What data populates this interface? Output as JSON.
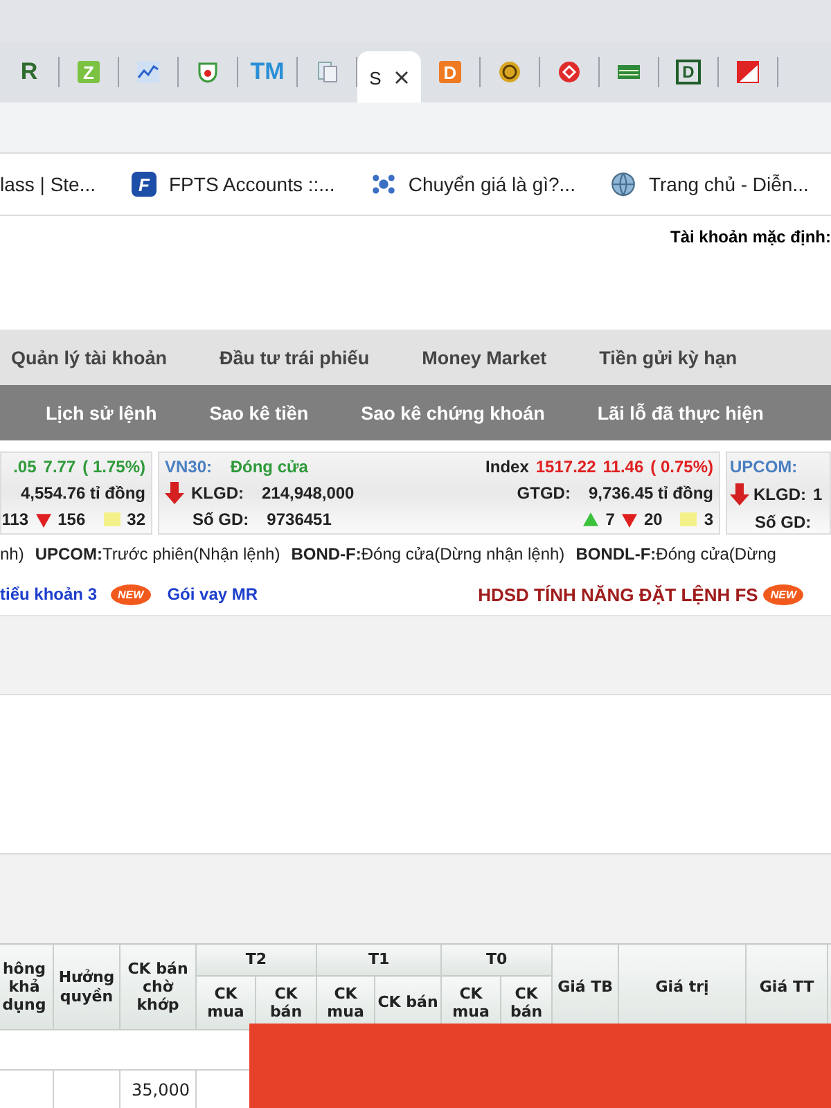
{
  "browser_tabs": [
    {
      "glyph": "R",
      "selected": false
    },
    {
      "glyph": "Z",
      "selected": false
    },
    {
      "selected": false
    },
    {
      "selected": false
    },
    {
      "glyph": "TM",
      "selected": false
    },
    {
      "selected": false
    },
    {
      "title": "S",
      "selected": true
    },
    {
      "glyph": "D",
      "selected": false
    },
    {
      "selected": false
    },
    {
      "selected": false
    },
    {
      "selected": false
    },
    {
      "glyph": "D",
      "selected": false
    },
    {
      "selected": false
    }
  ],
  "bookmarks": [
    {
      "label": "lass | Ste..."
    },
    {
      "glyph": "F",
      "label": "FPTS Accounts ::..."
    },
    {
      "label": "Chuyển giá là gì?..."
    },
    {
      "label": "Trang chủ - Diễn..."
    }
  ],
  "account_label": "Tài khoản mặc định:",
  "main_menu": [
    "Quản lý tài khoản",
    "Đầu tư trái phiếu",
    "Money Market",
    "Tiền gửi kỳ hạn"
  ],
  "sub_menu": [
    "Lịch sử lệnh",
    "Sao kê tiền",
    "Sao kê chứng khoán",
    "Lãi lỗ đã thực hiện"
  ],
  "market_left": {
    "index_value": ".05",
    "change": "7.77",
    "percent": "( 1.75%)",
    "gtgd": "4,554.76 tỉ đồng",
    "up": "113",
    "down": "156",
    "flat": "32"
  },
  "market_main": {
    "name": "VN30:",
    "status": "Đóng cửa",
    "klgd_label": "KLGD:",
    "klgd": "214,948,000",
    "sogd_label": "Số GD:",
    "sogd": "9736451",
    "index_label": "Index",
    "index_value": "1517.22",
    "change": "11.46",
    "percent": "( 0.75%)",
    "gtgd_label": "GTGD:",
    "gtgd": "9,736.45 tỉ đồng",
    "up": "7",
    "down": "20",
    "flat": "3"
  },
  "market_right": {
    "name": "UPCOM:",
    "klgd_label": "KLGD:",
    "klgd": "1",
    "sogd_label": "Số GD:"
  },
  "sessions": [
    {
      "value": "nh)"
    },
    {
      "label": "UPCOM:",
      "value": "Trước phiên(Nhận lệnh)"
    },
    {
      "label": "BOND-F:",
      "value": "Đóng cửa(Dừng nhận lệnh)"
    },
    {
      "label": "BONDL-F:",
      "value": "Đóng cửa(Dừng"
    }
  ],
  "links": [
    {
      "label": "tiểu khoản 3",
      "badge": "NEW"
    },
    {
      "label": "Gói vay MR"
    }
  ],
  "guide_link": {
    "label": "HDSD TÍNH NĂNG ĐẶT LỆNH FS",
    "badge": "NEW"
  },
  "table": {
    "columns": [
      "hông khả dụng",
      "Hưởng quyền",
      "CK bán chờ khớp"
    ],
    "groups": [
      {
        "label": "T2",
        "sub": [
          "CK mua",
          "CK bán"
        ]
      },
      {
        "label": "T1",
        "sub": [
          "CK mua",
          "CK bán"
        ]
      },
      {
        "label": "T0",
        "sub": [
          "CK mua",
          "CK bán"
        ]
      }
    ],
    "tail_columns": [
      "Giá TB",
      "Giá trị",
      "Giá TT"
    ],
    "rows": [
      [
        "",
        "",
        "",
        ""
      ],
      [
        "",
        "",
        "35,000",
        ""
      ]
    ]
  }
}
